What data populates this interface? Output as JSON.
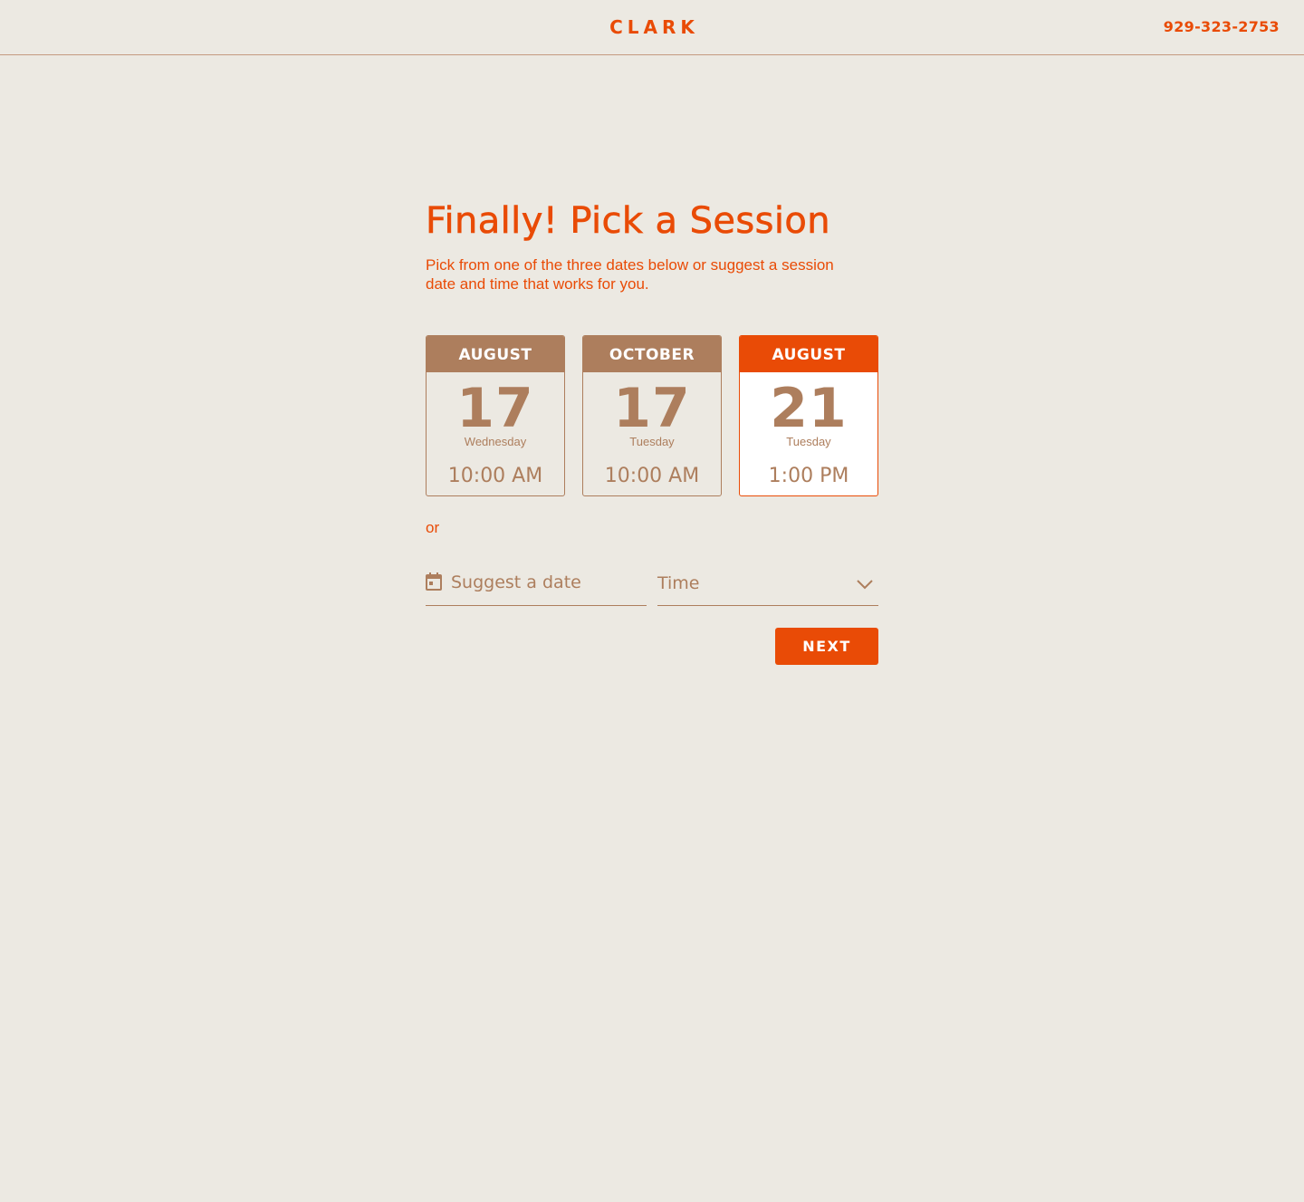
{
  "header": {
    "logo": "CLARK",
    "phone": "929-323-2753"
  },
  "main": {
    "title": "Finally! Pick a Session",
    "subtitle": "Pick from one of the three dates below or suggest a session date and time that works for you.",
    "sessions": [
      {
        "month": "AUGUST",
        "day": "17",
        "weekday": "Wednesday",
        "time": "10:00 AM",
        "selected": false
      },
      {
        "month": "OCTOBER",
        "day": "17",
        "weekday": "Tuesday",
        "time": "10:00 AM",
        "selected": false
      },
      {
        "month": "AUGUST",
        "day": "21",
        "weekday": "Tuesday",
        "time": "1:00 PM",
        "selected": true
      }
    ],
    "or_text": "or",
    "date_field": {
      "placeholder": "Suggest a date",
      "value": ""
    },
    "time_field": {
      "selected": "Time"
    },
    "next_label": "NEXT"
  },
  "colors": {
    "accent": "#e94b06",
    "brown": "#ad7e5d",
    "background": "#ece9e2",
    "card_selected_bg": "#ffffff"
  },
  "icons": {
    "date_field": "calendar-icon",
    "time_field": "chevron-down-icon"
  }
}
